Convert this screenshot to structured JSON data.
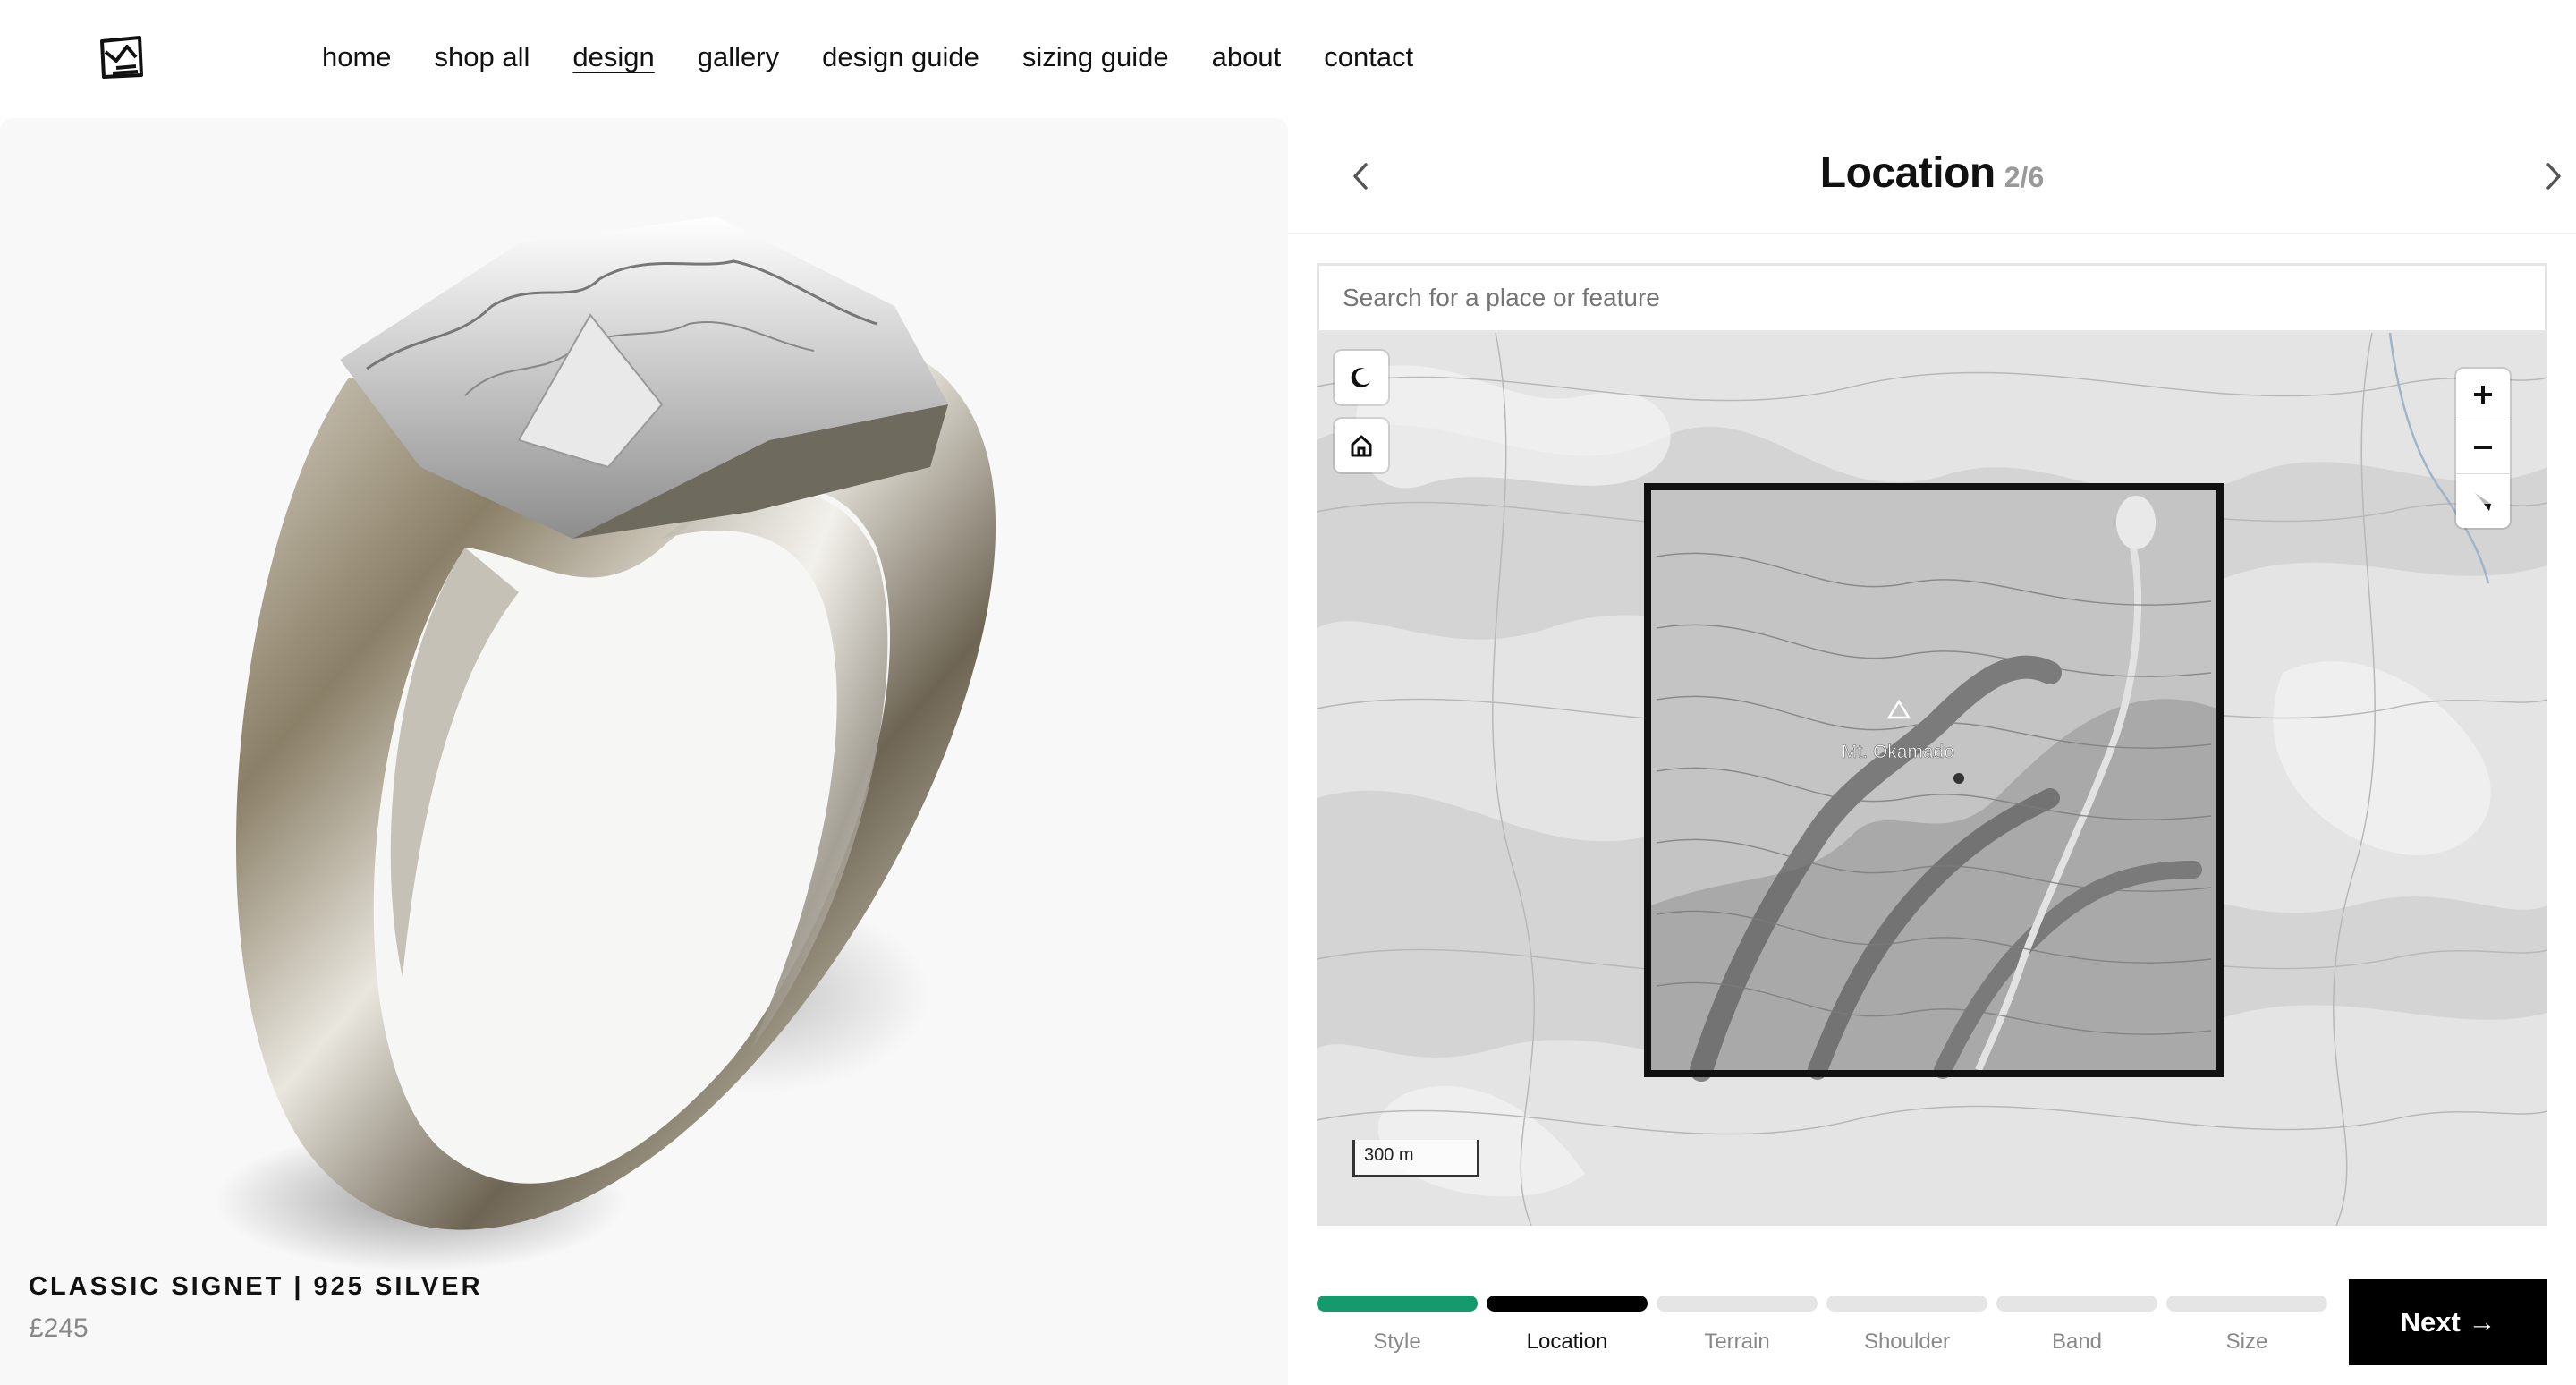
{
  "nav": {
    "items": [
      {
        "label": "home"
      },
      {
        "label": "shop all"
      },
      {
        "label": "design",
        "active": true
      },
      {
        "label": "gallery"
      },
      {
        "label": "design guide"
      },
      {
        "label": "sizing guide"
      },
      {
        "label": "about"
      },
      {
        "label": "contact"
      }
    ]
  },
  "product": {
    "title": "CLASSIC SIGNET | 925 SILVER",
    "price": "£245"
  },
  "step": {
    "title": "Location",
    "count": "2/6"
  },
  "search": {
    "placeholder": "Search for a place or feature"
  },
  "map": {
    "peak_label": "Mt. Okamado",
    "scale_label": "300 m"
  },
  "progress": {
    "steps": [
      {
        "label": "Style",
        "state": "done"
      },
      {
        "label": "Location",
        "state": "current"
      },
      {
        "label": "Terrain",
        "state": "todo"
      },
      {
        "label": "Shoulder",
        "state": "todo"
      },
      {
        "label": "Band",
        "state": "todo"
      },
      {
        "label": "Size",
        "state": "todo"
      }
    ]
  },
  "next_button": {
    "label": "Next →"
  },
  "colors": {
    "done": "#149a6c",
    "current": "#000000",
    "todo": "#e5e5e5"
  }
}
